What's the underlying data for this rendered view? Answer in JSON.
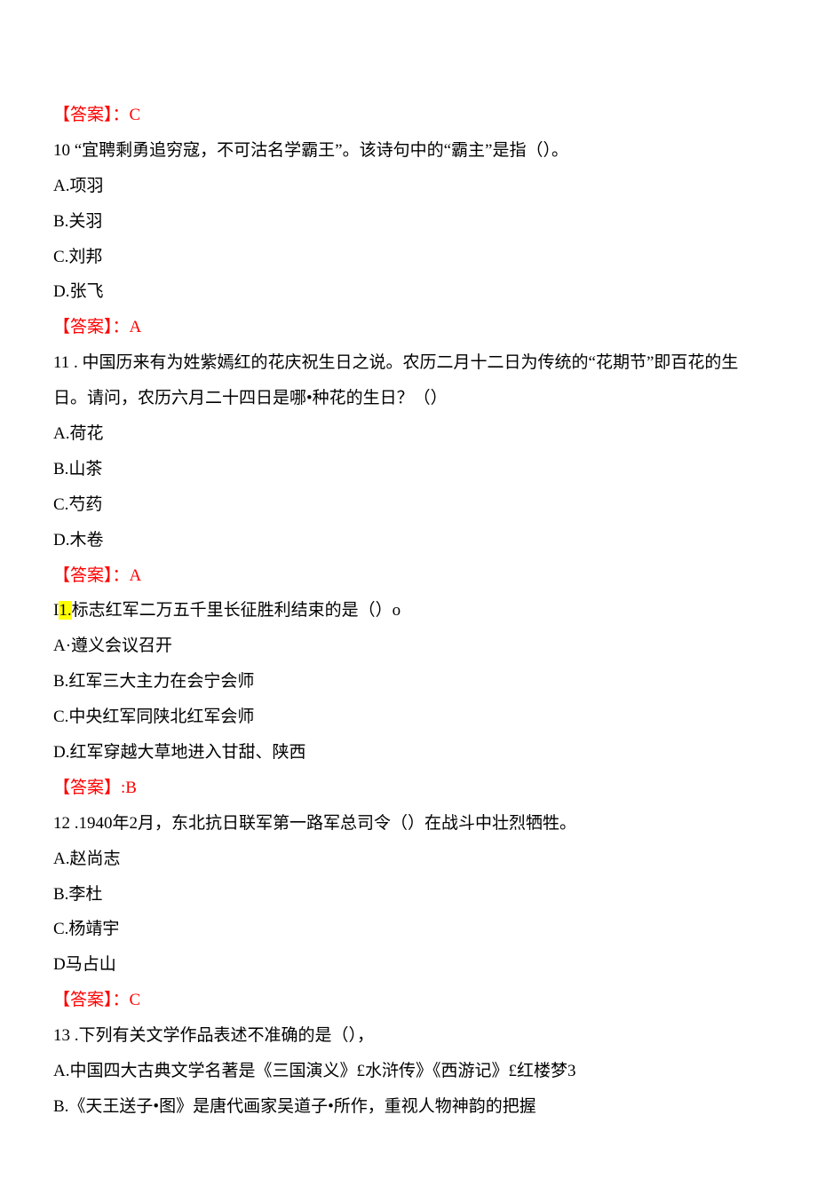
{
  "lines": [
    {
      "type": "answer",
      "text": "【答案】：C"
    },
    {
      "type": "plain",
      "text": "10 “宜聘剩勇追穷寇，不可沽名学霸王”。该诗句中的“霸主”是指（）。"
    },
    {
      "type": "plain",
      "text": "A.项羽"
    },
    {
      "type": "plain",
      "text": "B.关羽"
    },
    {
      "type": "plain",
      "text": "C.刘邦"
    },
    {
      "type": "plain",
      "text": "D.张飞"
    },
    {
      "type": "answer",
      "text": "【答案】：A"
    },
    {
      "type": "plain",
      "text": "11 . 中国历来有为姓紫嫣红的花庆祝生日之说。农历二月十二日为传统的“花期节”即百花的生日。请问，农历六月二十四日是哪•种花的生日？（）"
    },
    {
      "type": "plain",
      "text": "A.荷花"
    },
    {
      "type": "plain",
      "text": "B.山茶"
    },
    {
      "type": "plain",
      "text": "C.芍药"
    },
    {
      "type": "plain",
      "text": "D.木卷"
    },
    {
      "type": "answer",
      "text": "【答案】：A"
    },
    {
      "type": "highlight",
      "prefix": "I",
      "hl": "1.",
      "suffix": "标志红军二万五千里长征胜利结束的是（）o"
    },
    {
      "type": "plain",
      "text": "A·遵义会议召开"
    },
    {
      "type": "plain",
      "text": "B.红军三大主力在会宁会师"
    },
    {
      "type": "plain",
      "text": "C.中央红军同陕北红军会师"
    },
    {
      "type": "plain",
      "text": "D.红军穿越大草地进入甘甜、陕西"
    },
    {
      "type": "answer",
      "text": "【答案】:B"
    },
    {
      "type": "plain",
      "text": "12 .1940年2月，东北抗日联军第一路军总司令（）在战斗中壮烈牺牲。"
    },
    {
      "type": "plain",
      "text": "A.赵尚志"
    },
    {
      "type": "plain",
      "text": "B.李杜"
    },
    {
      "type": "plain",
      "text": "C.杨靖宇"
    },
    {
      "type": "plain",
      "text": "D马占山"
    },
    {
      "type": "answer",
      "text": "【答案】：C"
    },
    {
      "type": "plain",
      "text": "13 .下列有关文学作品表述不准确的是（），"
    },
    {
      "type": "plain",
      "text": "A.中国四大古典文学名著是《三国演义》£水浒传》《西游记》£红楼梦3"
    },
    {
      "type": "plain",
      "text": "B.《天王送子•图》是唐代画家吴道子•所作，重视人物神韵的把握"
    }
  ]
}
